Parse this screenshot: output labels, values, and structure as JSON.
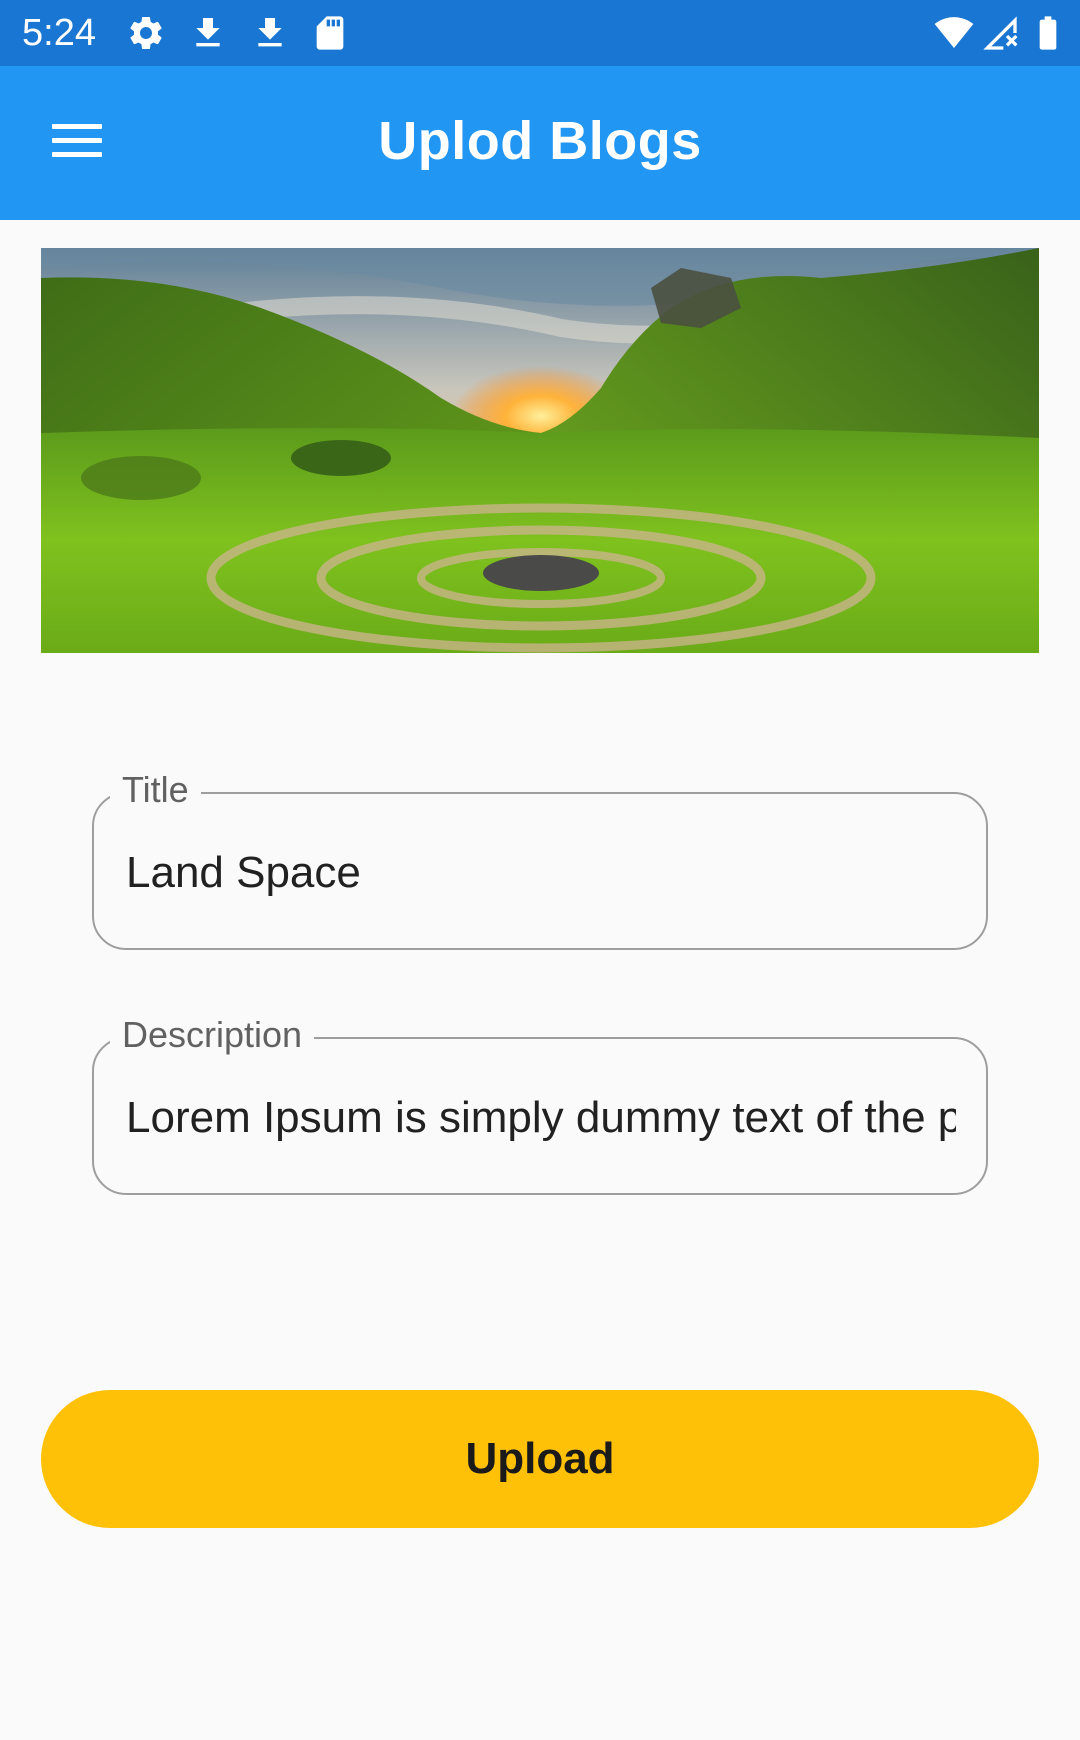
{
  "status_bar": {
    "time": "5:24",
    "icons_left": [
      "gear-icon",
      "download-icon",
      "download-icon",
      "sd-card-icon"
    ],
    "icons_right": [
      "wifi-icon",
      "signal-icon",
      "battery-icon"
    ],
    "color": "#1976d2"
  },
  "app_bar": {
    "title": "Uplod Blogs",
    "menu_icon": "menu-icon",
    "color": "#2196f3"
  },
  "hero_image": {
    "description_icon": "landscape-image"
  },
  "form": {
    "title_field": {
      "label": "Title",
      "value": "Land Space"
    },
    "description_field": {
      "label": "Description",
      "value": "Lorem Ipsum is simply dummy text of the printing"
    }
  },
  "upload_button": {
    "label": "Upload",
    "color": "#ffc107"
  }
}
